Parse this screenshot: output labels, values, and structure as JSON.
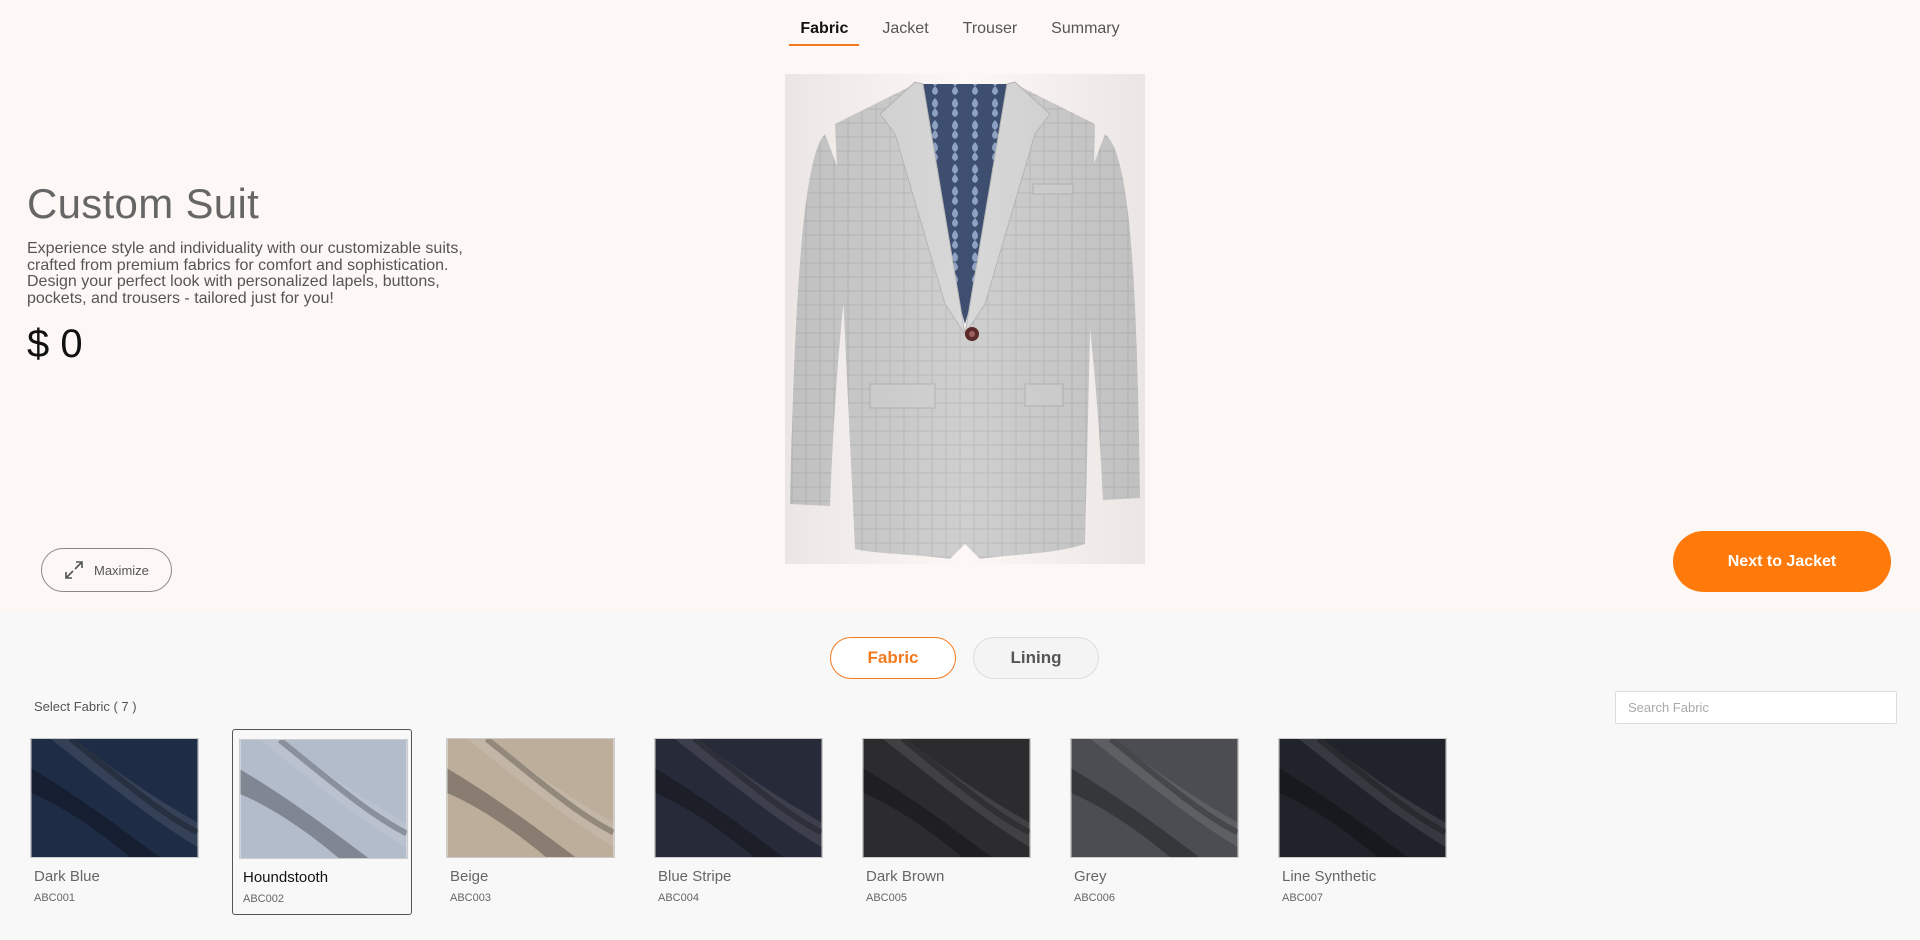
{
  "nav": {
    "tabs": [
      {
        "label": "Fabric",
        "active": true
      },
      {
        "label": "Jacket",
        "active": false
      },
      {
        "label": "Trouser",
        "active": false
      },
      {
        "label": "Summary",
        "active": false
      }
    ]
  },
  "product": {
    "title": "Custom Suit",
    "description": "Experience style and individuality with our customizable suits, crafted from premium fabrics for comfort and sophistication. Design your perfect look with personalized lapels, buttons, pockets, and trousers - tailored just for you!",
    "price": "$ 0"
  },
  "controls": {
    "maximize_label": "Maximize",
    "next_label": "Next to Jacket"
  },
  "panel": {
    "toggles": [
      {
        "label": "Fabric",
        "active": true
      },
      {
        "label": "Lining",
        "active": false
      }
    ],
    "select_label": "Select Fabric ( 7 )",
    "search_placeholder": "Search Fabric"
  },
  "fabrics": [
    {
      "name": "Dark Blue",
      "code": "ABC001",
      "color": "#1f2c45",
      "selected": false
    },
    {
      "name": "Houndstooth",
      "code": "ABC002",
      "color": "#b3bccb",
      "selected": true
    },
    {
      "name": "Beige",
      "code": "ABC003",
      "color": "#bdae9c",
      "selected": false
    },
    {
      "name": "Blue Stripe",
      "code": "ABC004",
      "color": "#272a38",
      "selected": false
    },
    {
      "name": "Dark Brown",
      "code": "ABC005",
      "color": "#2c2c2e",
      "selected": false
    },
    {
      "name": "Grey",
      "code": "ABC006",
      "color": "#4b4d52",
      "selected": false
    },
    {
      "name": "Line Synthetic",
      "code": "ABC007",
      "color": "#20232a",
      "selected": false
    }
  ],
  "colors": {
    "accent": "#ff7a0a"
  }
}
